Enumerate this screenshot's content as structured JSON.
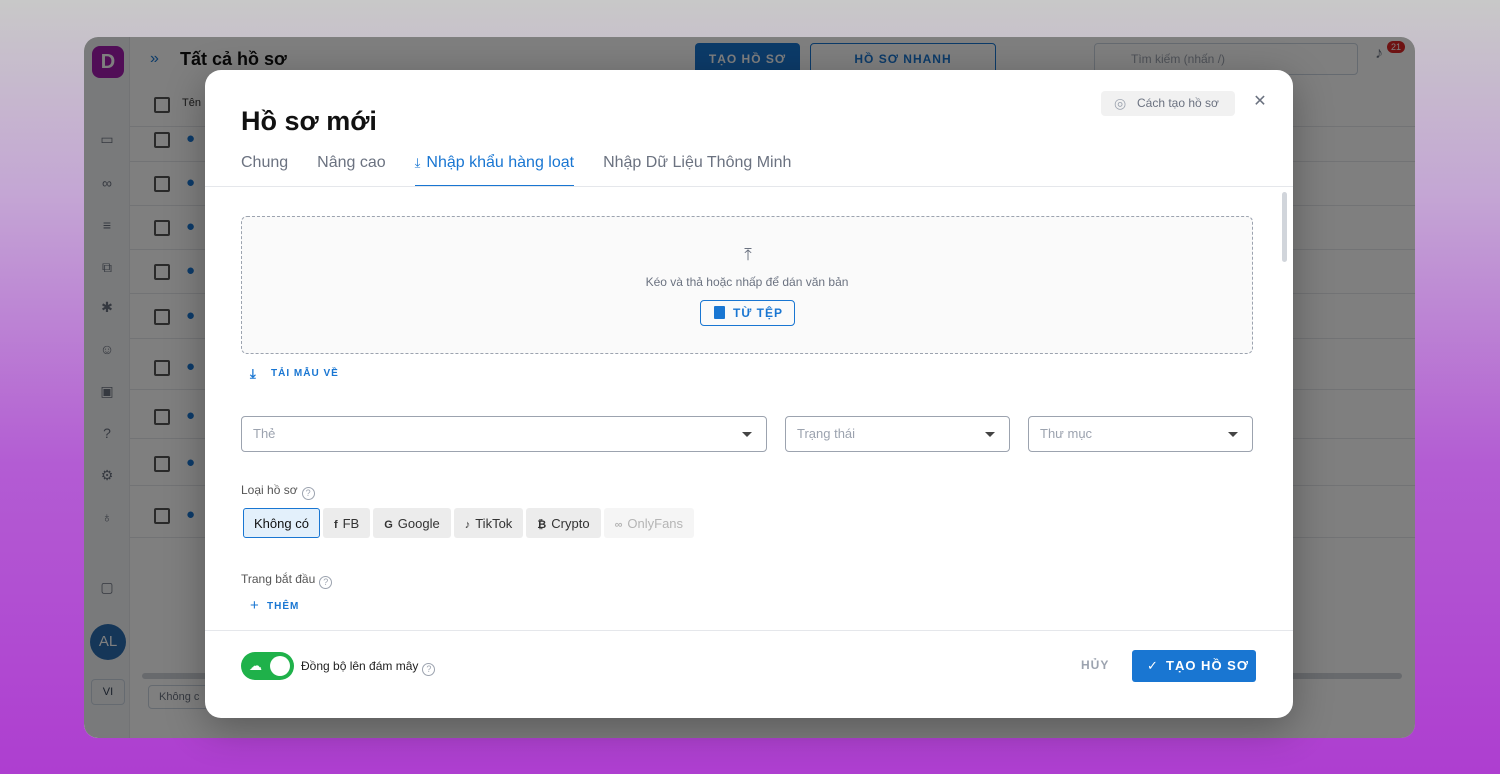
{
  "background_app": {
    "title": "Tất cả hồ sơ",
    "create_btn": "TẠO HỒ SƠ",
    "quick_btn": "HỒ SƠ NHANH",
    "search_placeholder": "Tìm kiếm (nhấn /)",
    "notif_count": "21",
    "table_header_name": "Tên",
    "avatar": "AL",
    "lang": "VI",
    "bottom_select": "Không c"
  },
  "modal": {
    "title": "Hồ sơ mới",
    "help_label": "Cách tạo hồ sơ",
    "tabs": [
      {
        "label": "Chung"
      },
      {
        "label": "Nâng cao"
      },
      {
        "label": "Nhập khẩu hàng loạt"
      },
      {
        "label": "Nhập Dữ Liệu Thông Minh"
      }
    ],
    "dropzone": {
      "text": "Kéo và thả hoặc nhấp để dán văn bản",
      "file_btn": "TỪ TỆP"
    },
    "download_template": "TẢI MẪU VỀ",
    "selects": {
      "tag_placeholder": "Thẻ",
      "status_placeholder": "Trạng thái",
      "folder_placeholder": "Thư mục"
    },
    "profile_type_label": "Loại hồ sơ",
    "profile_types": [
      {
        "label": "Không có"
      },
      {
        "label": "FB"
      },
      {
        "label": "Google"
      },
      {
        "label": "TikTok"
      },
      {
        "label": "Crypto"
      },
      {
        "label": "OnlyFans"
      }
    ],
    "start_page_label": "Trang bắt đầu",
    "add_btn": "THÊM",
    "sync_label": "Đồng bộ lên đám mây",
    "cancel_btn": "HỦY",
    "create_btn": "TẠO HỒ SƠ"
  },
  "colors": {
    "accent": "#1976d2",
    "toggle_on": "#1fb14a"
  }
}
